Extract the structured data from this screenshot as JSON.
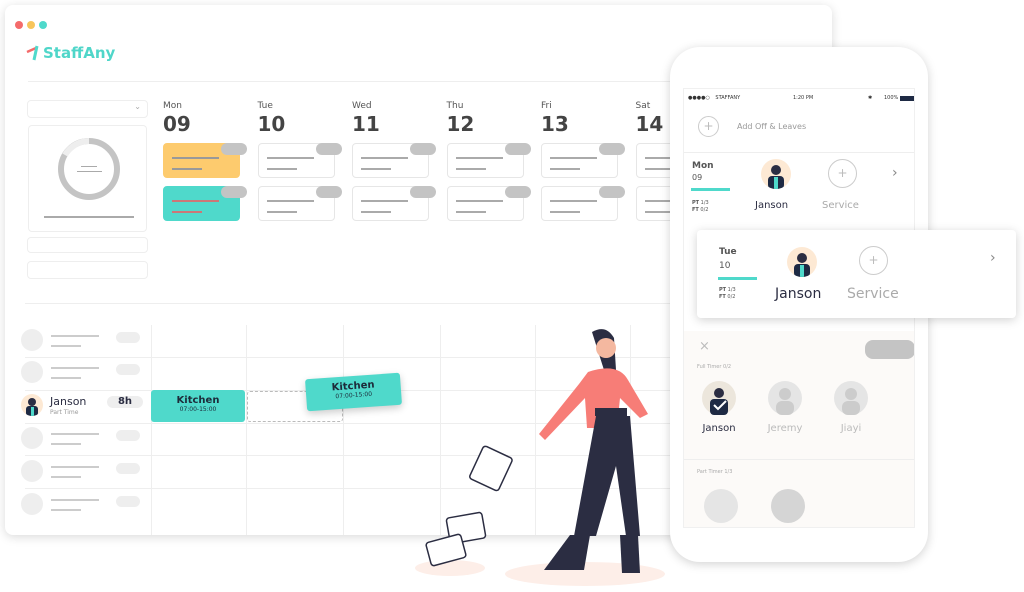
{
  "app": {
    "brand": "StaffAny"
  },
  "colors": {
    "accent": "#4fd9cb",
    "yellow": "#fdcb6e",
    "red_dot": "#f46b6b",
    "yellow_dot": "#f7c55b",
    "teal_dot": "#4fd9cb"
  },
  "calendar": {
    "days": [
      {
        "day": "Mon",
        "date": "09"
      },
      {
        "day": "Tue",
        "date": "10"
      },
      {
        "day": "Wed",
        "date": "11"
      },
      {
        "day": "Thu",
        "date": "12"
      },
      {
        "day": "Fri",
        "date": "13"
      },
      {
        "day": "Sat",
        "date": "14"
      }
    ]
  },
  "roster": {
    "employee": {
      "name": "Janson",
      "type": "Part Time",
      "hours": "8h"
    },
    "shifts": [
      {
        "label": "Kitchen",
        "time": "07:00-15:00"
      },
      {
        "label": "Kitchen",
        "time": "07:00-15:00"
      }
    ]
  },
  "mobile": {
    "status": {
      "carrier": "STAFFANY",
      "time": "1:20 PM",
      "battery": "100%"
    },
    "add_off": "Add Off & Leaves",
    "rows": [
      {
        "day": "Mon",
        "date": "09",
        "pt_label": "PT",
        "pt": "1/3",
        "ft_label": "FT",
        "ft": "0/2",
        "employee": "Janson",
        "role": "Service"
      },
      {
        "day": "Tue",
        "date": "10",
        "pt_label": "PT",
        "pt": "1/3",
        "ft_label": "FT",
        "ft": "0/2",
        "employee": "Janson",
        "role": "Service"
      }
    ],
    "full_timer_label": "Full Timer 0/2",
    "full_timers": [
      "Janson",
      "Jeremy",
      "Jiayi"
    ],
    "part_timer_label": "Part Timer 1/3"
  }
}
